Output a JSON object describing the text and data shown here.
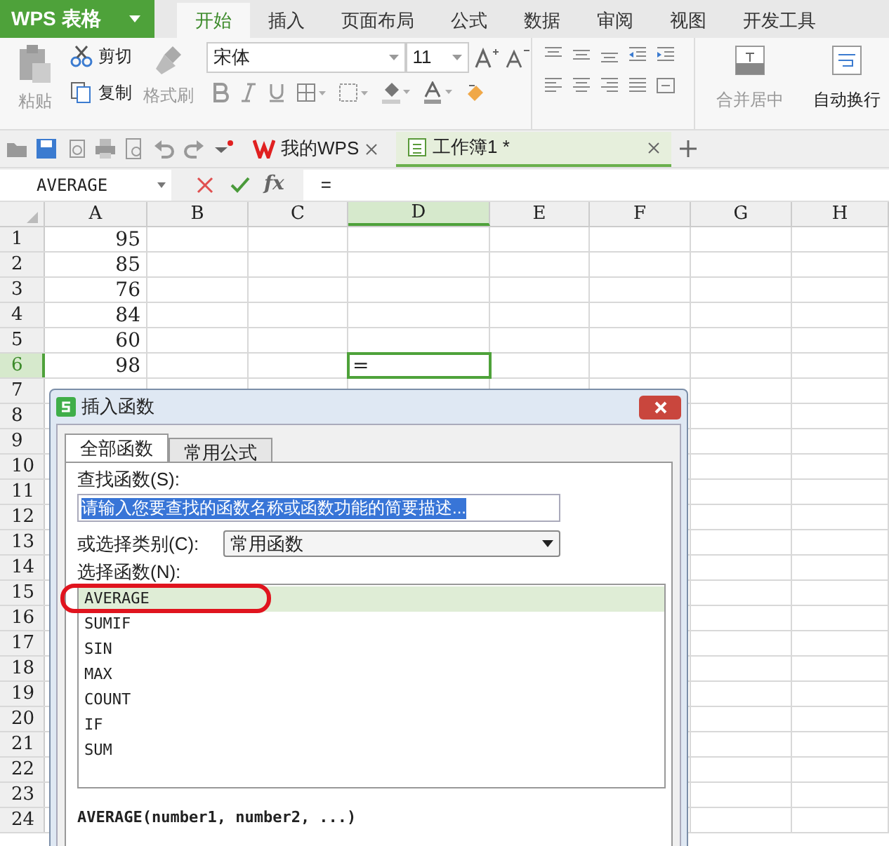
{
  "app_button": {
    "label": "WPS 表格"
  },
  "ribbon_tabs": [
    {
      "label": "开始",
      "selected": true
    },
    {
      "label": "插入",
      "selected": false
    },
    {
      "label": "页面布局",
      "selected": false
    },
    {
      "label": "公式",
      "selected": false
    },
    {
      "label": "数据",
      "selected": false
    },
    {
      "label": "审阅",
      "selected": false
    },
    {
      "label": "视图",
      "selected": false
    },
    {
      "label": "开发工具",
      "selected": false
    }
  ],
  "ribbon": {
    "paste": "粘贴",
    "cut": "剪切",
    "copy": "复制",
    "format_painter": "格式刷",
    "font": "宋体",
    "font_size": "11",
    "merge": "合并居中",
    "wrap": "自动换行"
  },
  "doc_tabs": [
    {
      "label": "我的WPS",
      "selected": false
    },
    {
      "label": "工作簿1 *",
      "selected": true
    }
  ],
  "formula_bar": {
    "name_box": "AVERAGE",
    "fx": "fx",
    "value": "="
  },
  "columns": [
    {
      "label": "A",
      "selected": false
    },
    {
      "label": "B",
      "selected": false
    },
    {
      "label": "C",
      "selected": false
    },
    {
      "label": "D",
      "selected": true
    },
    {
      "label": "E",
      "selected": false
    },
    {
      "label": "F",
      "selected": false
    },
    {
      "label": "G",
      "selected": false
    },
    {
      "label": "H",
      "selected": false
    }
  ],
  "rows": [
    {
      "label": "1",
      "selected": false,
      "a": "95"
    },
    {
      "label": "2",
      "selected": false,
      "a": "85"
    },
    {
      "label": "3",
      "selected": false,
      "a": "76"
    },
    {
      "label": "4",
      "selected": false,
      "a": "84"
    },
    {
      "label": "5",
      "selected": false,
      "a": "60"
    },
    {
      "label": "6",
      "selected": true,
      "a": "98",
      "d": "="
    },
    {
      "label": "7",
      "selected": false
    },
    {
      "label": "8",
      "selected": false
    },
    {
      "label": "9",
      "selected": false
    },
    {
      "label": "10",
      "selected": false
    },
    {
      "label": "11",
      "selected": false
    },
    {
      "label": "12",
      "selected": false
    },
    {
      "label": "13",
      "selected": false
    },
    {
      "label": "14",
      "selected": false
    },
    {
      "label": "15",
      "selected": false
    },
    {
      "label": "16",
      "selected": false
    },
    {
      "label": "17",
      "selected": false
    },
    {
      "label": "18",
      "selected": false
    },
    {
      "label": "19",
      "selected": false
    },
    {
      "label": "20",
      "selected": false
    },
    {
      "label": "21",
      "selected": false
    },
    {
      "label": "22",
      "selected": false
    },
    {
      "label": "23",
      "selected": false
    },
    {
      "label": "24",
      "selected": false
    }
  ],
  "dialog": {
    "title": "插入函数",
    "tabs": [
      {
        "label": "全部函数",
        "selected": true
      },
      {
        "label": "常用公式",
        "selected": false
      }
    ],
    "search_label": "查找函数(S):",
    "search_value": "请输入您要查找的函数名称或函数功能的简要描述...",
    "category_label": "或选择类别(C):",
    "category": "常用函数",
    "list_label": "选择函数(N):",
    "functions": [
      {
        "name": "AVERAGE",
        "selected": true,
        "circled": true
      },
      {
        "name": "SUMIF",
        "selected": false,
        "circled": false
      },
      {
        "name": "SIN",
        "selected": false,
        "circled": false
      },
      {
        "name": "MAX",
        "selected": false,
        "circled": false
      },
      {
        "name": "COUNT",
        "selected": false,
        "circled": false
      },
      {
        "name": "IF",
        "selected": false,
        "circled": false
      },
      {
        "name": "SUM",
        "selected": false,
        "circled": false
      }
    ],
    "signature": "AVERAGE(number1, number2, ...)"
  }
}
